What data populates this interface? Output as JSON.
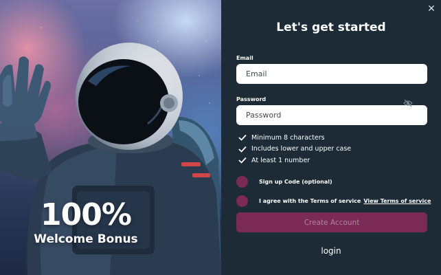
{
  "hero": {
    "bonus_percent": "100%",
    "bonus_label": "Welcome Bonus"
  },
  "form": {
    "title": "Let's get started",
    "email": {
      "label": "Email",
      "placeholder": "Email",
      "value": ""
    },
    "password": {
      "label": "Password",
      "placeholder": "Password",
      "value": ""
    },
    "requirements": [
      "Minimum 8 characters",
      "Includes lower and upper case",
      "At least 1 number"
    ],
    "signup_code_label": "Sign up Code (optional)",
    "terms_label": "I agree with the Terms of service",
    "terms_link": "View Terms of service",
    "create_button": "Create Account",
    "login_link": "login"
  },
  "icons": {
    "close": "close-icon",
    "password_toggle": "eye-off-icon",
    "requirement": "checkmark-icon"
  },
  "colors": {
    "panel_bg": "#1c2b35",
    "accent": "#7b2a55",
    "button_text": "#a98a9b",
    "text": "#ffffff"
  }
}
